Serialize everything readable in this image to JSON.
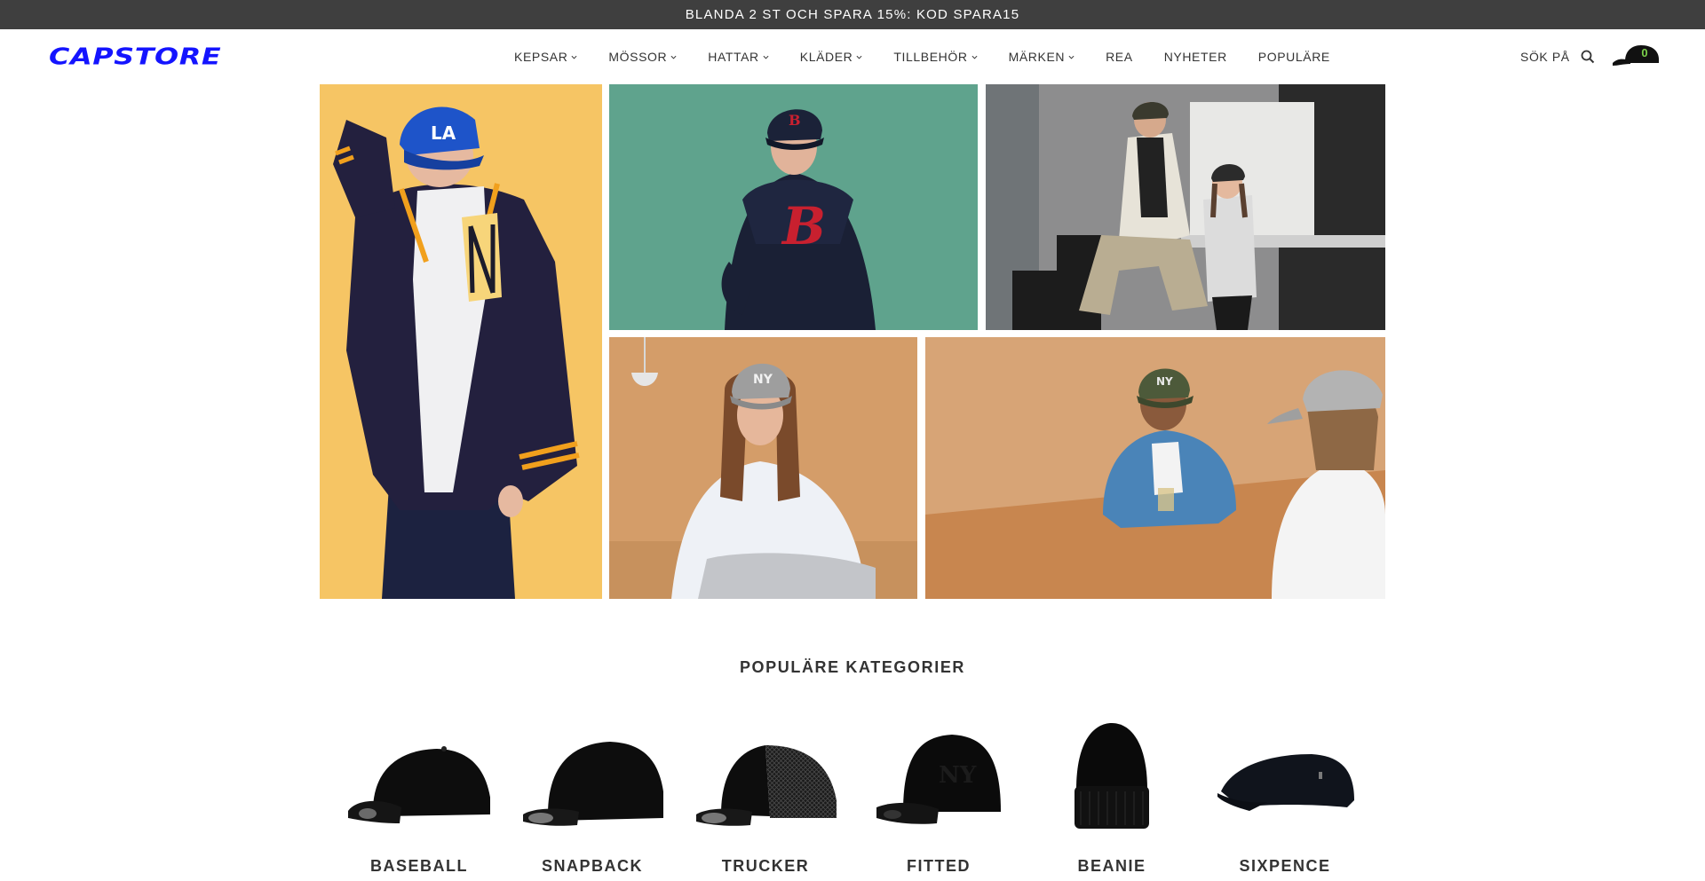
{
  "announcement": {
    "text": "BLANDA 2 ST OCH SPARA 15%: KOD SPARA15"
  },
  "header": {
    "logo": "CAPSTORE",
    "nav": [
      {
        "label": "KEPSAR",
        "dropdown": true
      },
      {
        "label": "MÖSSOR",
        "dropdown": true
      },
      {
        "label": "HATTAR",
        "dropdown": true
      },
      {
        "label": "KLÄDER",
        "dropdown": true
      },
      {
        "label": "TILLBEHÖR",
        "dropdown": true
      },
      {
        "label": "MÄRKEN",
        "dropdown": true
      },
      {
        "label": "REA",
        "dropdown": false
      },
      {
        "label": "NYHETER",
        "dropdown": false
      },
      {
        "label": "POPULÄRE",
        "dropdown": false
      }
    ],
    "search_label": "SÖK PÅ",
    "search_icon": "magnifier",
    "cart_icon": "cap-icon",
    "cart_count": "0"
  },
  "hero": {
    "tiles": [
      {
        "name": "hero-tile-varsity-jacket",
        "subject": "person-blue-cap-navy-varsity-jacket",
        "bg": "#f7c869"
      },
      {
        "name": "hero-tile-boston-hoodie",
        "subject": "person-navy-hoodie",
        "bg": "#5fa38d"
      },
      {
        "name": "hero-tile-couple-studio",
        "subject": "two-people-sitting",
        "bg": "#8f8f8f"
      },
      {
        "name": "hero-tile-grey-cap-woman",
        "subject": "woman-grey-cap",
        "bg": "#d7a06a"
      },
      {
        "name": "hero-tile-table-conversation",
        "subject": "two-people-at-table",
        "bg": "#d7a476"
      }
    ]
  },
  "popular": {
    "title": "POPULÄRE KATEGORIER",
    "categories": [
      {
        "label": "BASEBALL",
        "icon": "baseball-cap"
      },
      {
        "label": "SNAPBACK",
        "icon": "snapback-cap"
      },
      {
        "label": "TRUCKER",
        "icon": "trucker-cap"
      },
      {
        "label": "FITTED",
        "icon": "fitted-cap"
      },
      {
        "label": "BEANIE",
        "icon": "beanie"
      },
      {
        "label": "SIXPENCE",
        "icon": "sixpence-cap"
      }
    ]
  },
  "colors": {
    "announcement_bg": "#3f3f3f",
    "logo_blue": "#1414ff",
    "cart_count_green": "#7bd14a"
  }
}
